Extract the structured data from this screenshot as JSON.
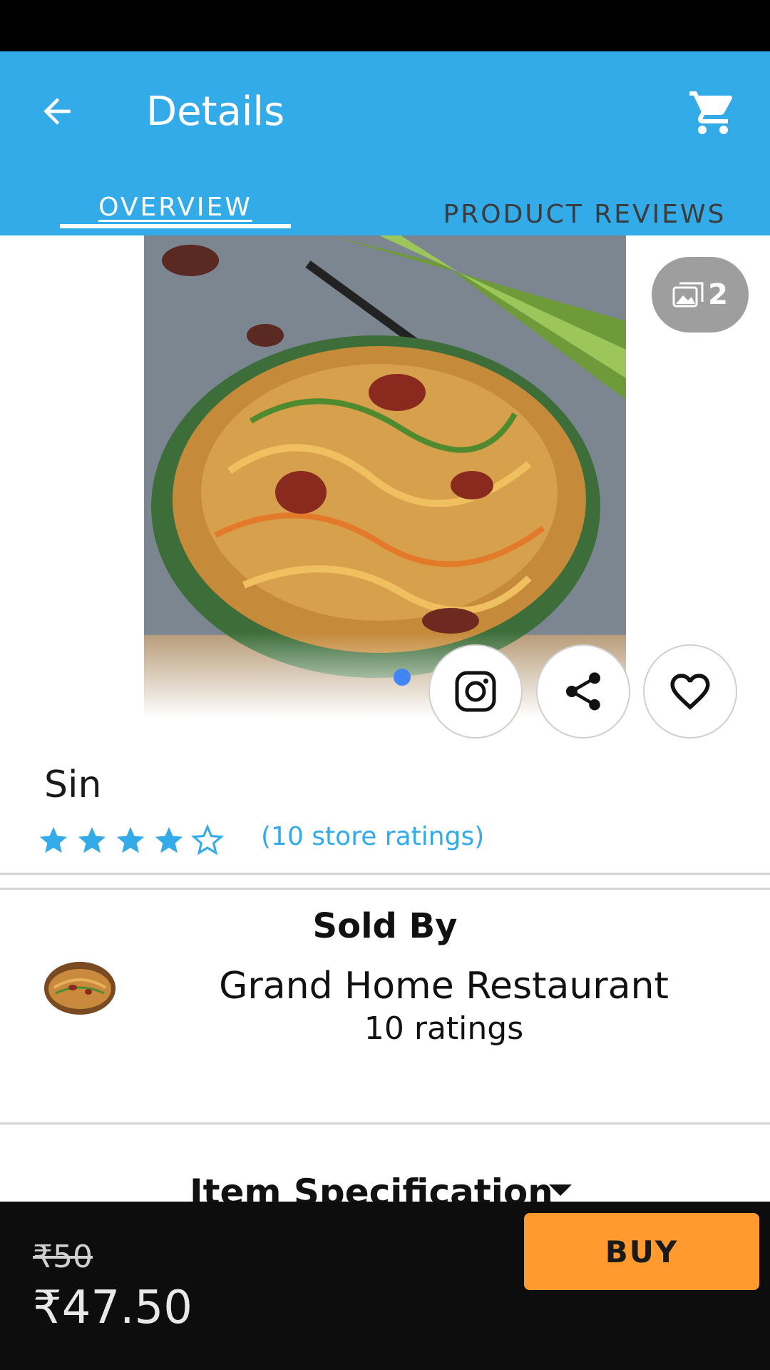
{
  "app_bar": {
    "title": "Details",
    "back_icon": "arrow-left-icon",
    "cart_icon": "shopping-cart-icon",
    "background_color": "#33abe9"
  },
  "tabs": [
    {
      "label": "OVERVIEW",
      "selected": true
    },
    {
      "label": "PRODUCT REVIEWS",
      "selected": false
    }
  ],
  "gallery": {
    "image_count": "2",
    "gallery_icon": "gallery-images-icon",
    "current_page": 1
  },
  "actions": [
    {
      "icon": "instagram-icon"
    },
    {
      "icon": "share-icon"
    },
    {
      "icon": "heart-outline-icon"
    }
  ],
  "product": {
    "name": "Sin",
    "rating": 4,
    "rating_max": 5,
    "ratings_text": "(10 store ratings)"
  },
  "seller": {
    "heading": "Sold By",
    "name": "Grand Home Restaurant",
    "ratings": "10 ratings"
  },
  "specification": {
    "label": "Item Specification",
    "expand_icon": "caret-down-icon"
  },
  "purchase": {
    "old_price": "₹50",
    "price": "₹47.50",
    "buy_label": "BUY",
    "buy_color": "#ff9a2e"
  }
}
